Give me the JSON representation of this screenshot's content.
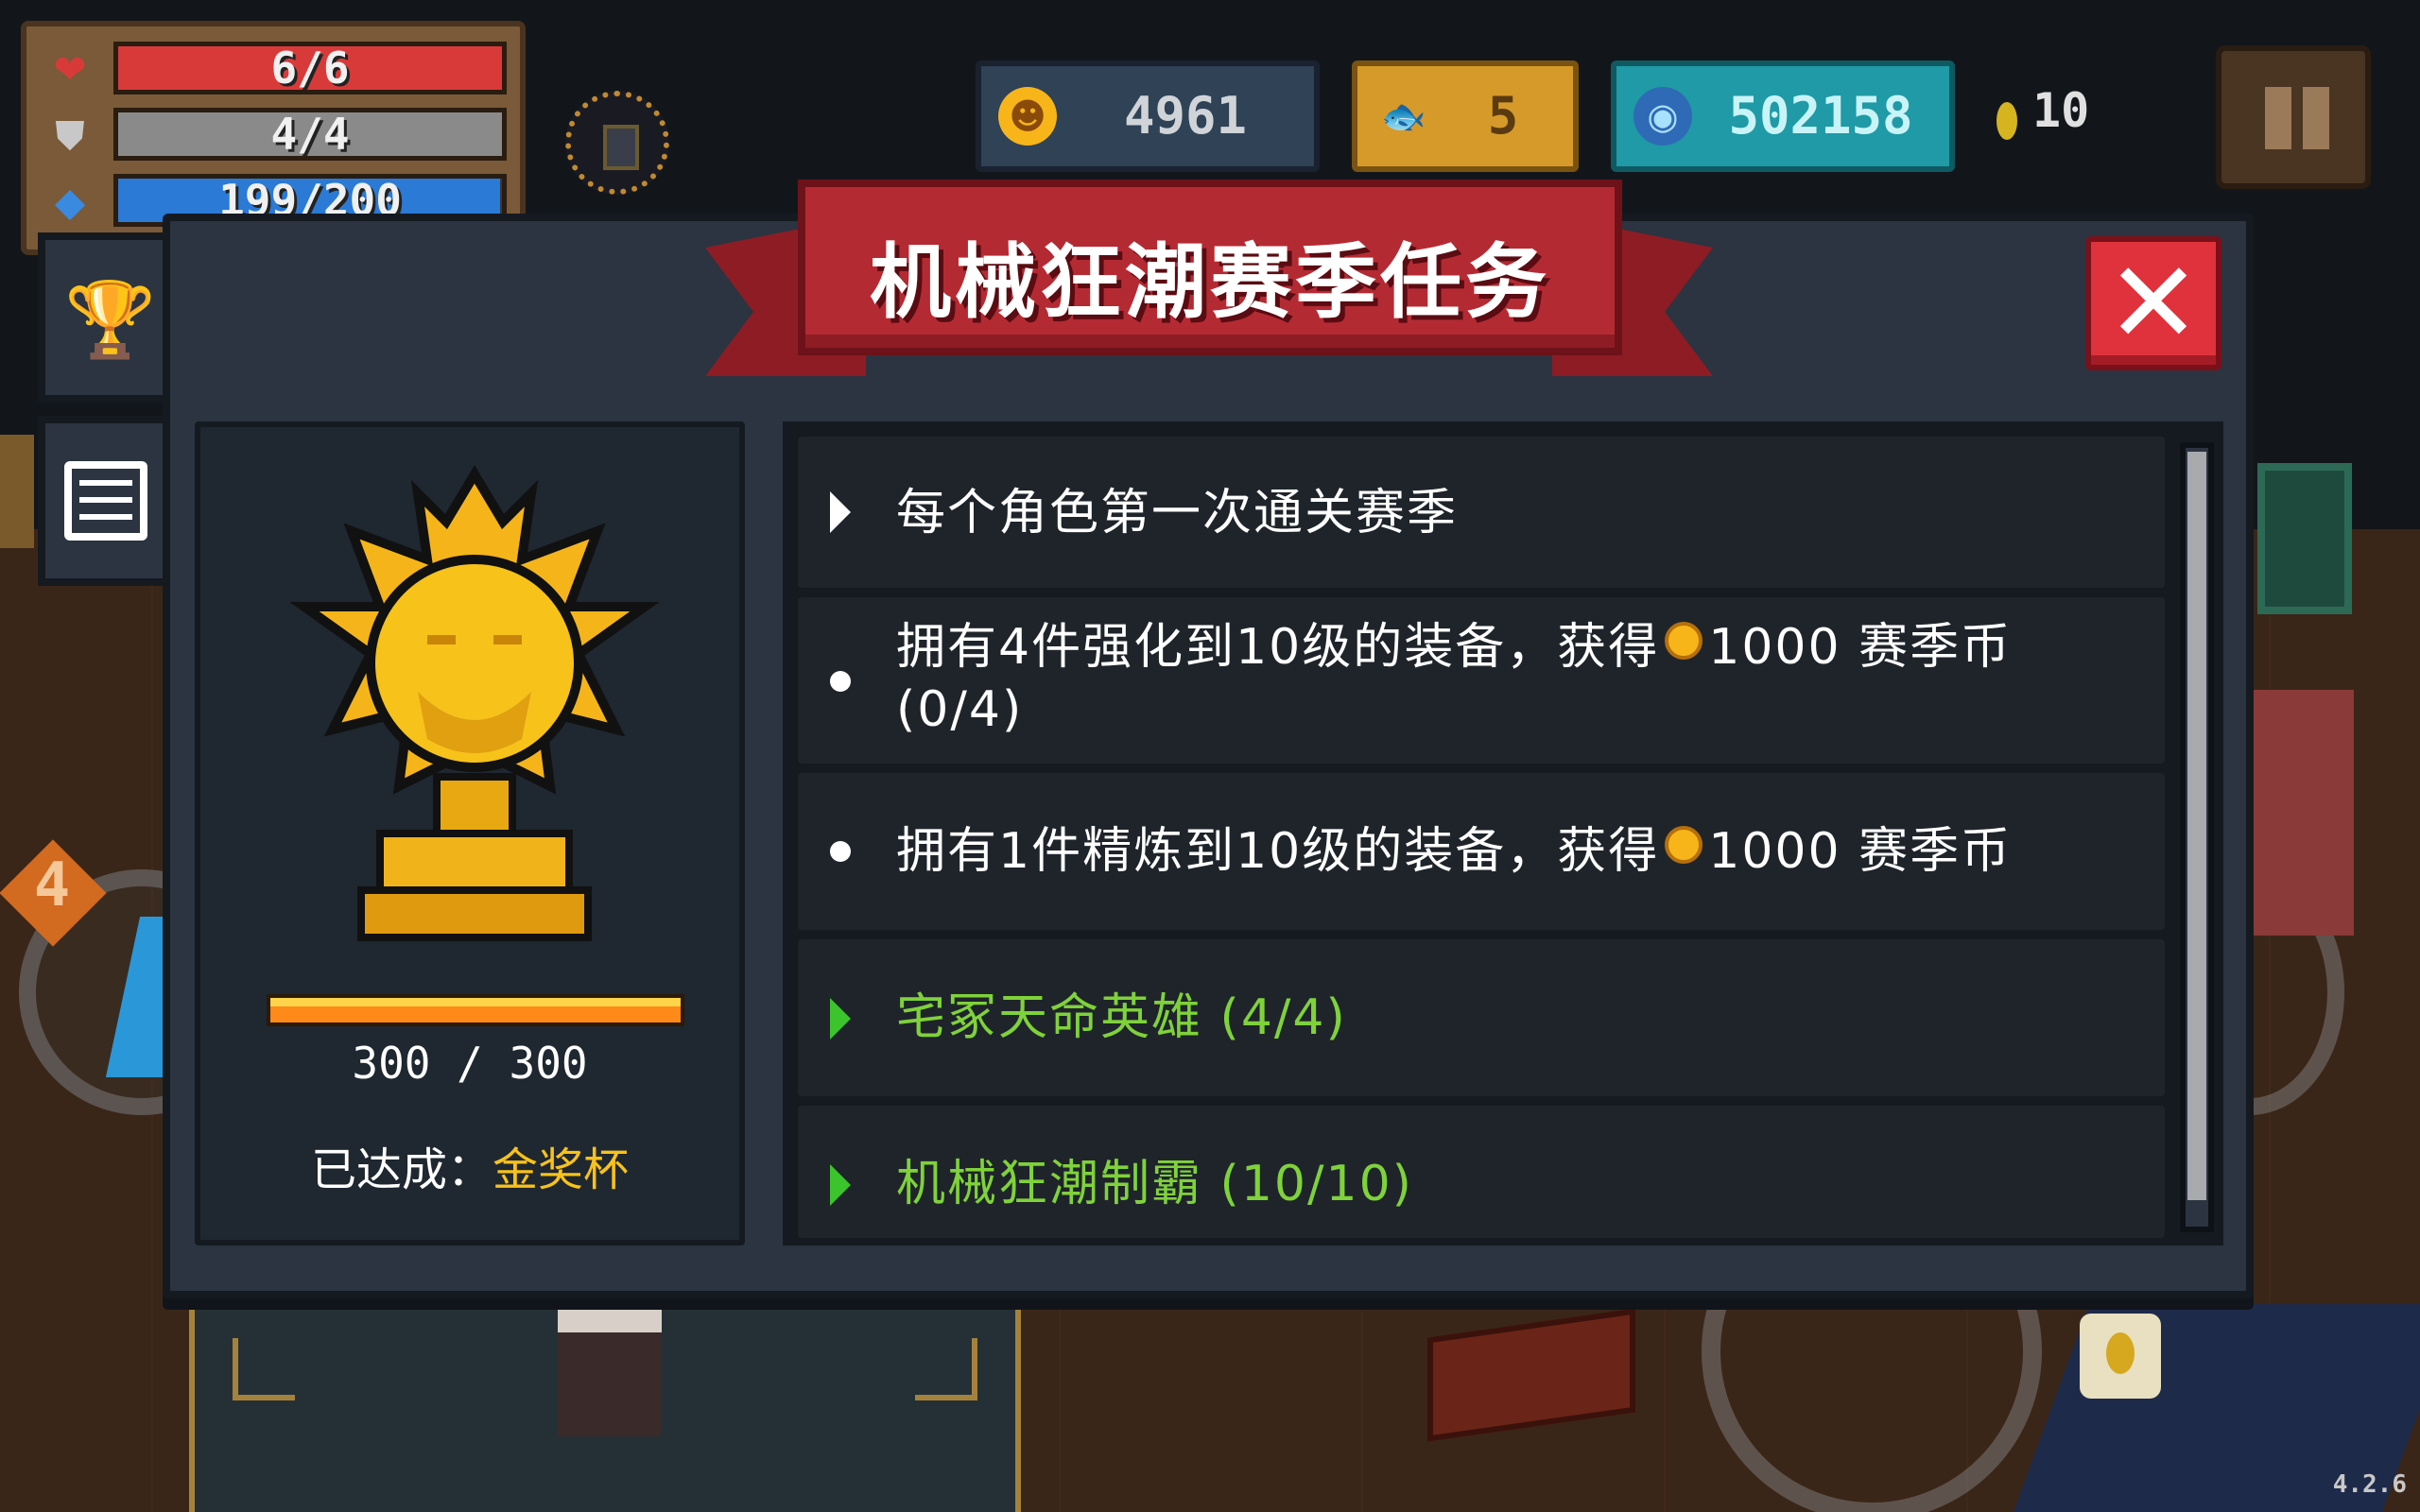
{
  "hud": {
    "health": {
      "label": "6/6",
      "fraction": 1.0,
      "color": "#d83a3a"
    },
    "armor": {
      "label": "4/4",
      "fraction": 1.0,
      "color": "#8a8a8a"
    },
    "energy": {
      "label": "199/200",
      "fraction": 0.995,
      "color": "#2a7ad6"
    },
    "season_coins": "4961",
    "fish": "5",
    "gems": "502158",
    "small_gems": "10"
  },
  "icons": {
    "heart": "heart-icon",
    "shield": "shield-icon",
    "diamond": "energy-diamond-icon",
    "coin": "season-coin-icon",
    "fish": "fish-icon",
    "gem": "gem-icon",
    "pause": "pause-icon",
    "close": "close-icon",
    "trophy": "trophy-icon",
    "list": "list-icon"
  },
  "modal": {
    "title": "机械狂潮赛季任务",
    "close_label": "✕",
    "tabs": [
      {
        "name": "trophy",
        "glyph": "🏆"
      },
      {
        "name": "list",
        "glyph": ""
      }
    ],
    "trophy": {
      "progress_text": "300  /  300",
      "progress_fraction": 1.0,
      "achieved_label": "已达成：",
      "achieved_value": "金奖杯"
    },
    "tasks": [
      {
        "type": "header",
        "text": "每个角色第一次通关赛季",
        "color": "white"
      },
      {
        "type": "item",
        "text_before": "拥有4件强化到10级的装备，获得",
        "reward": "1000 赛季币",
        "line2": "(0/4)"
      },
      {
        "type": "item",
        "text_before": "拥有1件精炼到10级的装备，获得",
        "reward": "1000 赛季币"
      },
      {
        "type": "header",
        "text": "宅冢天命英雄 (4/4)",
        "color": "green"
      },
      {
        "type": "header",
        "text": "机械狂潮制霸 (10/10)",
        "color": "green"
      }
    ]
  },
  "level_badge": "4",
  "version": "4.2.6",
  "colors": {
    "ribbon": "#b42a33",
    "close": "#e0323c",
    "gold": "#f7c21a",
    "green_text": "#7fd23a",
    "panel": "#2b3440"
  }
}
